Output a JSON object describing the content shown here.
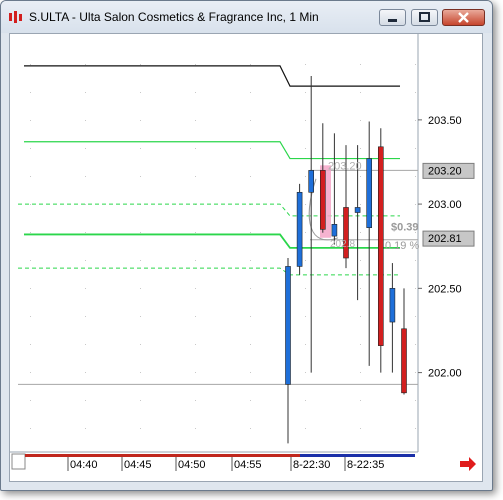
{
  "window": {
    "title": "S.ULTA - Ulta Salon Cosmetics & Fragrance Inc, 1 Min",
    "icon": "bar-chart-icon",
    "buttons": {
      "minimize": "minimize-icon",
      "maximize": "maximize-icon",
      "close": "close-icon"
    }
  },
  "chart": {
    "price_labels": [
      "203.50",
      "203.00",
      "202.50",
      "202.00"
    ],
    "price_label_values": [
      203.5,
      203.0,
      202.5,
      202.0
    ],
    "price_tags": [
      {
        "text": "203.20",
        "value": 203.2
      },
      {
        "text": "202.81",
        "value": 202.81
      }
    ],
    "time_labels": [
      "04:40",
      "04:45",
      "04:50",
      "04:55",
      "8-22:30",
      "8-22:35"
    ],
    "annotations": {
      "price_box": "203.20",
      "change": "$0.39",
      "change_percent": "0.19 %",
      "small_value": "202.8"
    },
    "arrow_icon": "right-arrow-icon",
    "colors": {
      "up": "#1e6fd9",
      "down": "#d21f1f",
      "pink": "#f4a6c8",
      "green": "#2bd64b",
      "dark": "#111111"
    }
  },
  "chart_data": {
    "type": "candlestick",
    "y_range": [
      201.6,
      203.95
    ],
    "candles": [
      {
        "open": 201.93,
        "high": 202.68,
        "low": 201.58,
        "close": 202.63
      },
      {
        "open": 202.63,
        "high": 203.12,
        "low": 202.58,
        "close": 203.07
      },
      {
        "open": 203.07,
        "high": 203.76,
        "low": 202.0,
        "close": 203.2
      },
      {
        "open": 203.2,
        "high": 203.48,
        "low": 202.83,
        "close": 202.85
      },
      {
        "open": 202.81,
        "high": 203.42,
        "low": 202.76,
        "close": 202.88
      },
      {
        "open": 202.98,
        "high": 203.35,
        "low": 202.62,
        "close": 202.68
      },
      {
        "open": 202.95,
        "high": 203.35,
        "low": 202.43,
        "close": 202.98
      },
      {
        "open": 202.86,
        "high": 203.49,
        "low": 202.04,
        "close": 203.27
      },
      {
        "open": 203.34,
        "high": 203.45,
        "low": 202.0,
        "close": 202.16
      },
      {
        "open": 202.3,
        "high": 202.65,
        "low": 202.0,
        "close": 202.5
      },
      {
        "open": 202.26,
        "high": 202.5,
        "low": 201.87,
        "close": 201.88
      }
    ],
    "levels": {
      "black": {
        "before": 203.82,
        "after": 203.7
      },
      "green_upper": {
        "before": 203.37,
        "after": 203.27
      },
      "green_upper_dashed": {
        "before": 203.0,
        "after": 202.93
      },
      "green_mid": {
        "before": 202.82,
        "after": 202.74
      },
      "green_lower_dashed": {
        "before": 202.62,
        "after": 202.58
      }
    },
    "gray_lines": [
      203.2,
      202.8,
      201.93
    ]
  }
}
